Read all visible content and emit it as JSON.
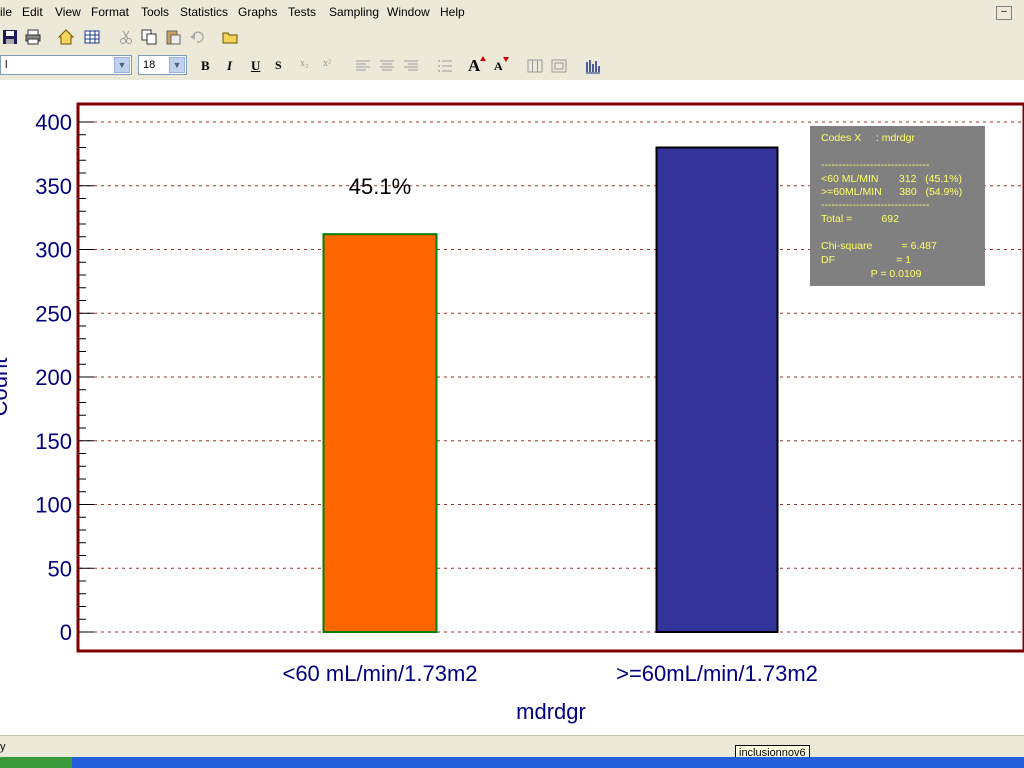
{
  "menubar": {
    "items": [
      "ile",
      "Edit",
      "View",
      "Format",
      "Tools",
      "Statistics",
      "Graphs",
      "Tests",
      "Sampling",
      "Window",
      "Help"
    ],
    "minimize": "–"
  },
  "toolbar": {
    "font_combo_value": "l",
    "size_combo_value": "18",
    "bold": "B",
    "italic": "I",
    "underline": "U",
    "strike": "S",
    "subscript": "x₂",
    "superscript": "x²",
    "grow_font": "A",
    "shrink_font": "A"
  },
  "chart_data": {
    "type": "bar",
    "categories": [
      "<60 mL/min/1.73m2",
      ">=60mL/min/1.73m2"
    ],
    "values": [
      312,
      380
    ],
    "bar_colors": [
      "#ff6600",
      "#333399"
    ],
    "bar_borders": [
      "#008000",
      "#000000"
    ],
    "data_labels": [
      "45.1%",
      ""
    ],
    "xlabel": "mdrdgr",
    "ylabel": "Count",
    "ylim": [
      0,
      400
    ],
    "yticks": [
      0,
      50,
      100,
      150,
      200,
      250,
      300,
      350,
      400
    ],
    "grid": true,
    "frame_color": "#800000",
    "grid_color": "#993333",
    "axis_text_color": "#000080"
  },
  "stats_box": {
    "lines": [
      "Codes X     : mdrdgr",
      "",
      "-------------------------------",
      "<60 ML/MIN       312   (45.1%)",
      ">=60ML/MIN      380   (54.9%)",
      "-------------------------------",
      "Total =          692",
      "",
      "Chi-square          = 6.487",
      "DF                     = 1",
      "                 P = 0.0109"
    ]
  },
  "statusbar": {
    "text": "y"
  },
  "tooltip": {
    "text": "inclusionnov6"
  }
}
